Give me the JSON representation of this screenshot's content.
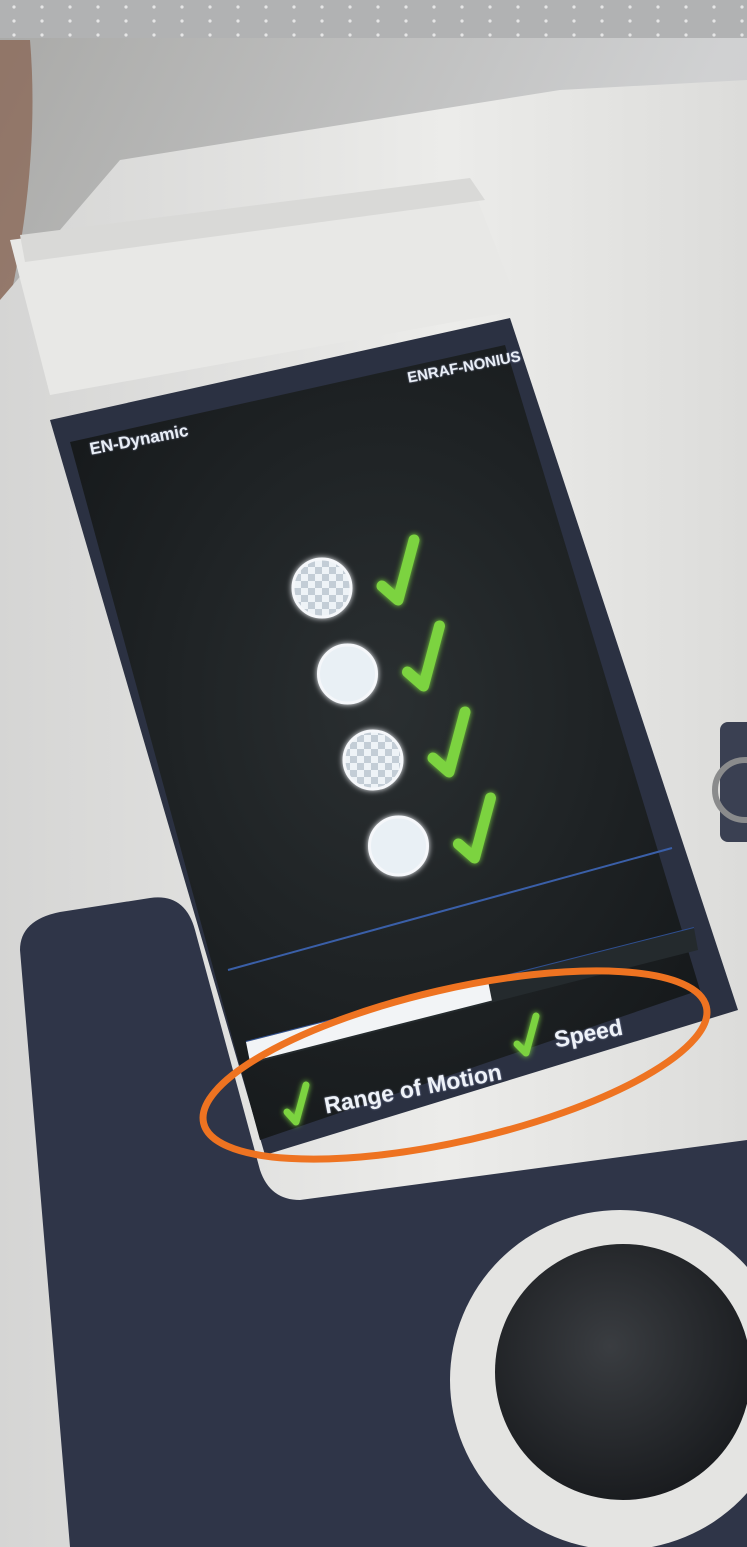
{
  "screen": {
    "brand_left": "EN-Dynamic",
    "brand_right": "ENRAF-NONIUS"
  },
  "exercise_steps": [
    {
      "icon": "patterned-circle-icon",
      "status": "check-icon"
    },
    {
      "icon": "solid-circle-icon",
      "status": "check-icon"
    },
    {
      "icon": "patterned-circle-icon",
      "status": "check-icon"
    },
    {
      "icon": "solid-circle-icon",
      "status": "check-icon"
    }
  ],
  "progress": {
    "fraction": 0.6
  },
  "footer": {
    "range_of_motion": "Range of Motion",
    "speed": "Speed"
  },
  "highlight_color": "#ee7321",
  "check_color": "#7bd33f"
}
